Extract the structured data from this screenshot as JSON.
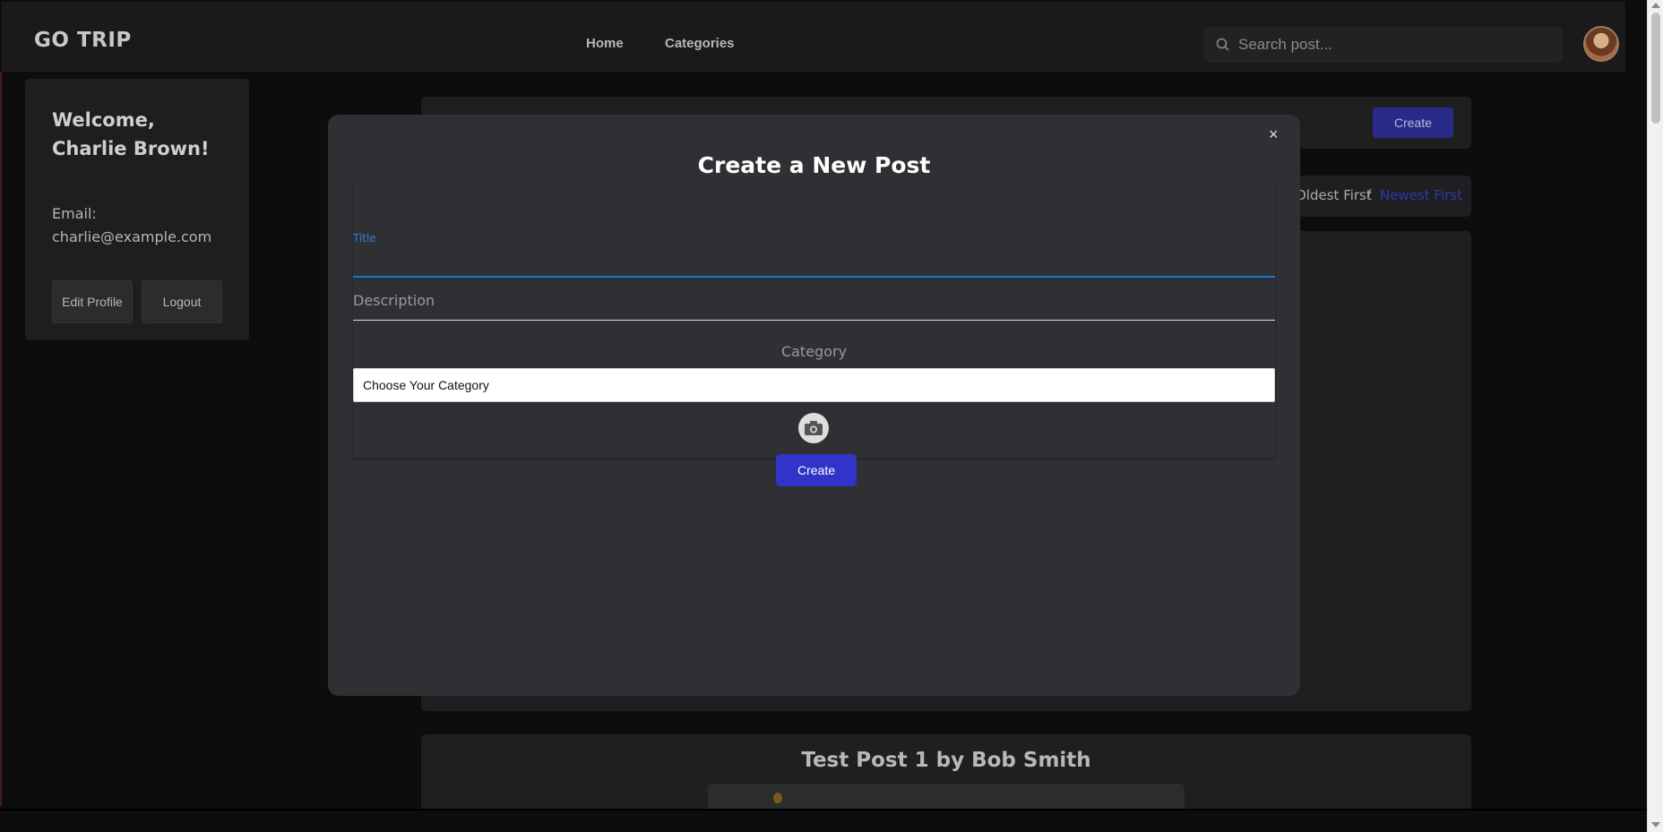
{
  "navbar": {
    "brand": "GO TRIP",
    "links": [
      "Home",
      "Categories"
    ],
    "search_placeholder": "Search post..."
  },
  "profile": {
    "welcome": "Welcome, Charlie Brown!",
    "email_label": "Email:",
    "email": "charlie@example.com",
    "edit_label": "Edit Profile",
    "logout_label": "Logout"
  },
  "feed": {
    "create_label": "Create",
    "sort_oldest": "Oldest First",
    "sort_separator": "/",
    "sort_newest": "Newest First",
    "post_title": "Test Post 1 by Bob Smith"
  },
  "modal": {
    "title": "Create a New Post",
    "close": "×",
    "title_label": "Title",
    "description_placeholder": "Description",
    "category_label": "Category",
    "category_selected": "Choose Your Category",
    "submit_label": "Create"
  },
  "colors": {
    "accent": "#3034c8",
    "focus": "#1976d2",
    "modal_bg": "#2f3033"
  }
}
